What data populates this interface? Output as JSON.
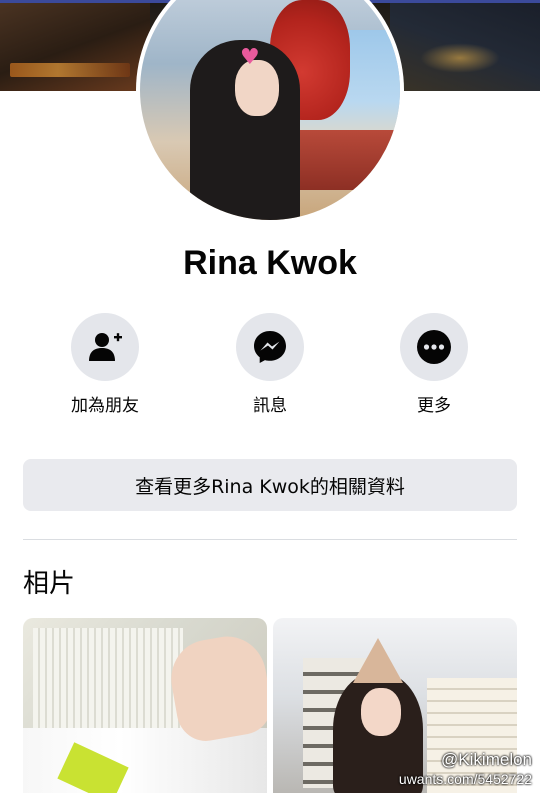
{
  "profile": {
    "name": "Rina Kwok"
  },
  "actions": [
    {
      "label": "加為朋友",
      "icon": "add-friend-icon"
    },
    {
      "label": "訊息",
      "icon": "messenger-icon"
    },
    {
      "label": "更多",
      "icon": "more-icon"
    }
  ],
  "more_button": {
    "label": "查看更多Rina Kwok的相關資料"
  },
  "photos_section": {
    "title": "相片"
  },
  "watermark": {
    "handle": "@Kikimelon",
    "url": "uwants.com/5452722"
  },
  "colors": {
    "accent": "#3b4a9b",
    "button_bg": "#e4e6eb",
    "text": "#050505"
  }
}
